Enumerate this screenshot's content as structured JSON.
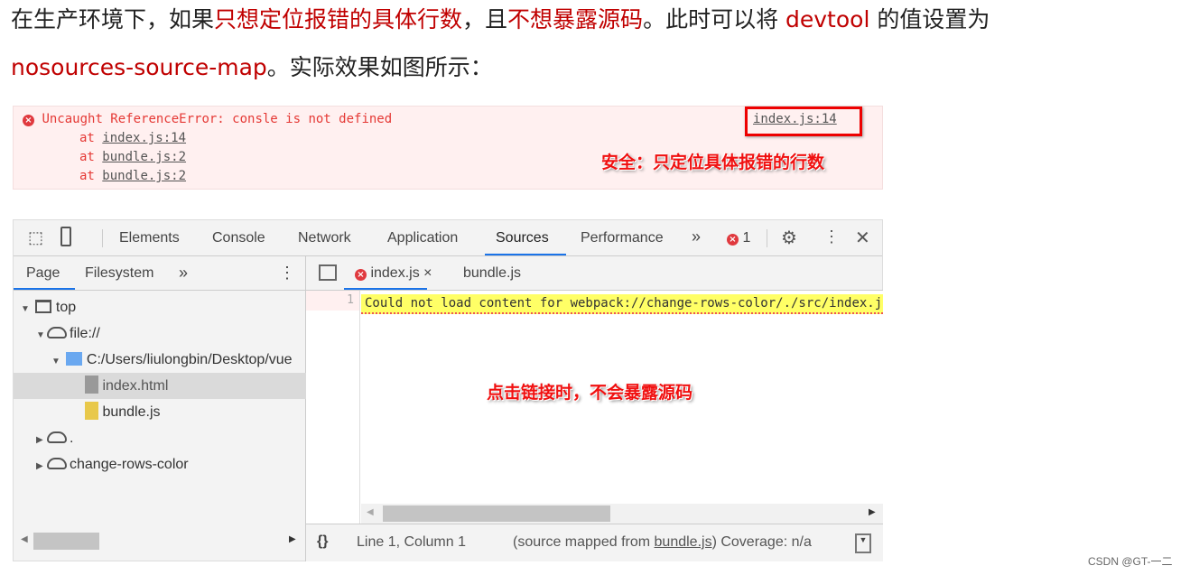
{
  "intro": {
    "l1_a": "在生产环境下，如果",
    "l1_b": "只想定位报错的具体行数",
    "l1_c": "，且",
    "l1_d": "不想暴露源码",
    "l1_e": "。此时可以将 ",
    "l1_f": "devtool",
    "l1_g": " 的值设置为",
    "l2_a": "nosources-source-map",
    "l2_b": "。实际效果如图所示："
  },
  "colors": {
    "accent_red": "#c00000",
    "error_bg": "#fff0f0",
    "highlight": "#ffff66",
    "tab_underline": "#1a73e8"
  },
  "console_error": {
    "message": "Uncaught ReferenceError: consle is not defined",
    "link": "index.js:14",
    "stack": [
      {
        "at": "at",
        "file": "index.js:14"
      },
      {
        "at": "at",
        "file": "bundle.js:2"
      },
      {
        "at": "at",
        "file": "bundle.js:2"
      }
    ],
    "annotation": "安全：只定位具体报错的行数"
  },
  "devtools": {
    "tabs": [
      "Elements",
      "Console",
      "Network",
      "Application",
      "Sources",
      "Performance"
    ],
    "active_tab": "Sources",
    "more": "»",
    "error_count": "1",
    "navigator_tabs": [
      "Page",
      "Filesystem"
    ],
    "editor_tabs": [
      "index.js",
      "bundle.js"
    ],
    "tree": {
      "top": "top",
      "file": "file://",
      "folder": "C:/Users/liulongbin/Desktop/vue",
      "index": "index.html",
      "bundle": "bundle.js",
      "dot": ".",
      "crc": "change-rows-color"
    },
    "line_number": "1",
    "code": "Could not load content for webpack://change-rows-color/./src/index.js",
    "annotation": "点击链接时，不会暴露源码",
    "status": {
      "braces": "{}",
      "position": "Line 1, Column 1",
      "mapped_a": "(source mapped from ",
      "mapped_link": "bundle.js",
      "mapped_b": ")",
      "coverage": "Coverage: n/a"
    }
  },
  "footer": "CSDN @GT-一二"
}
